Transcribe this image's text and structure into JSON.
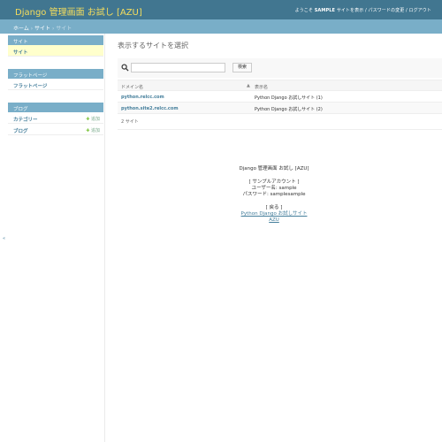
{
  "header": {
    "site_name": "Django 管理画面 お試し [AZU]",
    "welcome": "ようこそ",
    "username": "SAMPLE",
    "links": [
      "サイトを表示",
      "パスワードの変更",
      "ログアウト"
    ],
    "separator": " / "
  },
  "breadcrumbs": {
    "home": "ホーム",
    "app": "サイト",
    "current": "サイト",
    "separator": " › "
  },
  "sidebar": {
    "modules": [
      {
        "caption": "サイト",
        "rows": [
          {
            "label": "サイト",
            "current": true
          }
        ]
      },
      {
        "caption": "フラットページ",
        "rows": [
          {
            "label": "フラットページ"
          }
        ]
      },
      {
        "caption": "ブログ",
        "rows": [
          {
            "label": "カテゴリー",
            "add": "追加"
          },
          {
            "label": "ブログ",
            "add": "追加"
          }
        ]
      }
    ],
    "toggle": "«"
  },
  "main": {
    "title": "表示するサイトを選択",
    "search": {
      "value": "",
      "placeholder": "",
      "button": "検索"
    },
    "table": {
      "headers": [
        "ドメイン名",
        "表示名"
      ],
      "sort_indicator": "▲",
      "rows": [
        [
          "python.relcc.com",
          "Python Django お試しサイト (1)"
        ],
        [
          "python.site2.relcc.com",
          "Python Django お試しサイト (2)"
        ]
      ]
    },
    "paginator": "2 サイト"
  },
  "footer": {
    "title": "Django 管理画面 お試し [AZU]",
    "account_heading": "[ サンプルアカウント ]",
    "username_line": "ユーザー名: sample",
    "password_line": "パスワード: samplesample",
    "back_heading": "[ 戻る ]",
    "back_link_line1": "Python Django お試しサイト",
    "back_link_line2": "AZU"
  },
  "colors": {
    "header_bg": "#417690",
    "brand": "#f5dd5d",
    "module_caption_bg": "#79aec8",
    "link": "#447e9b",
    "current_row_bg": "#ffffcc",
    "add_icon": "#70bf2b"
  }
}
